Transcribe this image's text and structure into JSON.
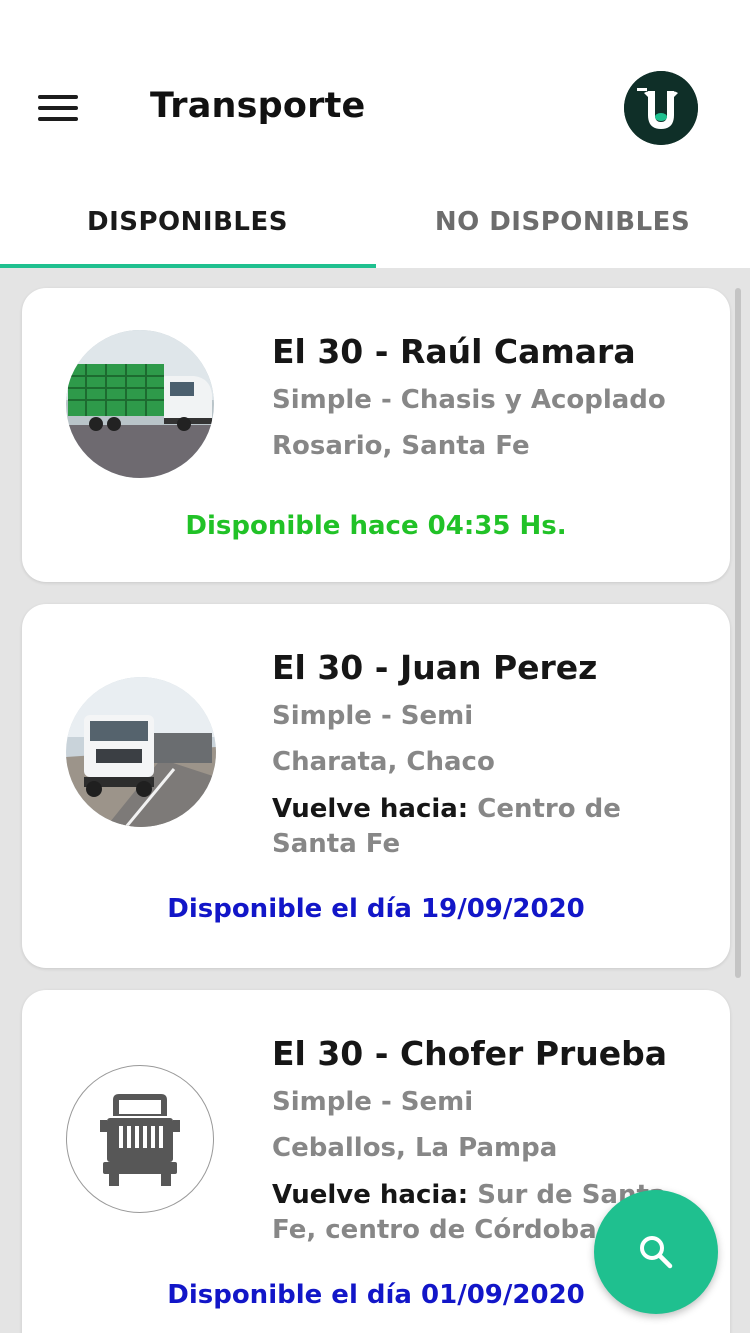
{
  "header": {
    "title": "Transporte",
    "menu_icon": "hamburger-menu-icon",
    "logo_icon": "brand-logo"
  },
  "tabs": [
    {
      "label": "DISPONIBLES",
      "active": true
    },
    {
      "label": "NO DISPONIBLES",
      "active": false
    }
  ],
  "accent_color": "#1fc08f",
  "cards": [
    {
      "name": "El 30 - Raúl Camara",
      "type": "Simple - Chasis y Acoplado",
      "location": "Rosario, Santa Fe",
      "status": "Disponible hace 04:35 Hs.",
      "status_color": "#21c227",
      "photo": "cattle-truck-photo"
    },
    {
      "name": "El 30 - Juan Perez",
      "type": "Simple - Semi",
      "location": "Charata, Chaco",
      "returns_label": "Vuelve hacia:",
      "returns_value": "Centro de Santa Fe",
      "status": "Disponible el día 19/09/2020",
      "status_color": "#1216c8",
      "photo": "semi-truck-photo"
    },
    {
      "name": "El 30 - Chofer Prueba",
      "type": "Simple - Semi",
      "location": "Ceballos, La Pampa",
      "returns_label": "Vuelve hacia:",
      "returns_value": "Sur de Santa Fe, centro de Córdoba",
      "status": "Disponible el día 01/09/2020",
      "status_color": "#1216c8",
      "photo": "truck-placeholder-icon"
    }
  ],
  "fab": {
    "icon": "search-icon"
  }
}
